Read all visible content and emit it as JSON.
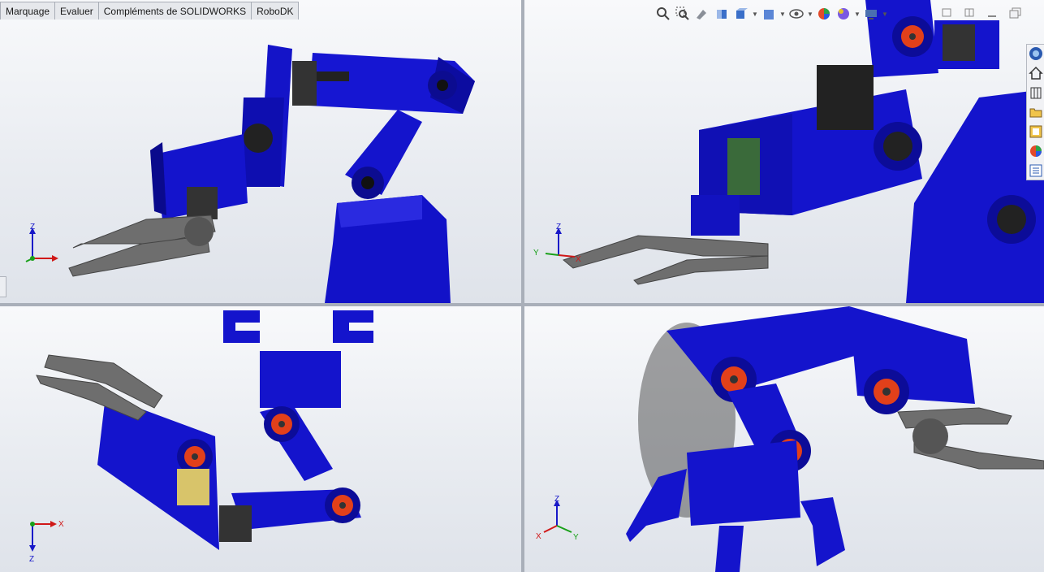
{
  "command_manager": {
    "tabs": [
      {
        "label": "Marquage"
      },
      {
        "label": "Evaluer"
      },
      {
        "label": "Compléments de SOLIDWORKS"
      },
      {
        "label": "RoboDK"
      }
    ]
  },
  "heads_up_toolbar": {
    "tools": [
      {
        "icon": "zoom-to-fit-icon"
      },
      {
        "icon": "zoom-to-area-icon"
      },
      {
        "icon": "previous-view-icon"
      },
      {
        "icon": "section-view-icon"
      },
      {
        "icon": "view-orientation-icon"
      },
      {
        "icon": "display-style-icon"
      },
      {
        "icon": "hide-show-items-icon"
      },
      {
        "icon": "edit-appearance-icon"
      },
      {
        "icon": "apply-scene-icon"
      },
      {
        "icon": "view-settings-icon"
      }
    ]
  },
  "task_pane": {
    "tabs": [
      {
        "icon": "solidworks-resources-icon"
      },
      {
        "icon": "home-icon"
      },
      {
        "icon": "design-library-icon"
      },
      {
        "icon": "file-explorer-icon"
      },
      {
        "icon": "view-palette-icon"
      },
      {
        "icon": "appearances-scenes-icon"
      },
      {
        "icon": "custom-properties-icon"
      }
    ]
  },
  "viewports": [
    {
      "name": "top-left",
      "triad": {
        "x": "",
        "y": "",
        "z": "Z"
      }
    },
    {
      "name": "top-right",
      "triad": {
        "x": "X",
        "y": "Y",
        "z": "Z"
      }
    },
    {
      "name": "bottom-left",
      "triad": {
        "x": "X",
        "y": "",
        "z": "Z"
      }
    },
    {
      "name": "bottom-right",
      "triad": {
        "x": "X",
        "y": "Y",
        "z": "Z"
      }
    }
  ],
  "colors": {
    "model_blue": "#1010d0",
    "model_blue_dark": "#0a0a8c",
    "servo_orange": "#e2401a",
    "gripper_gray": "#6e6e6e",
    "triad_red": "#d01818",
    "triad_green": "#18a018",
    "triad_blue": "#1818c8"
  }
}
